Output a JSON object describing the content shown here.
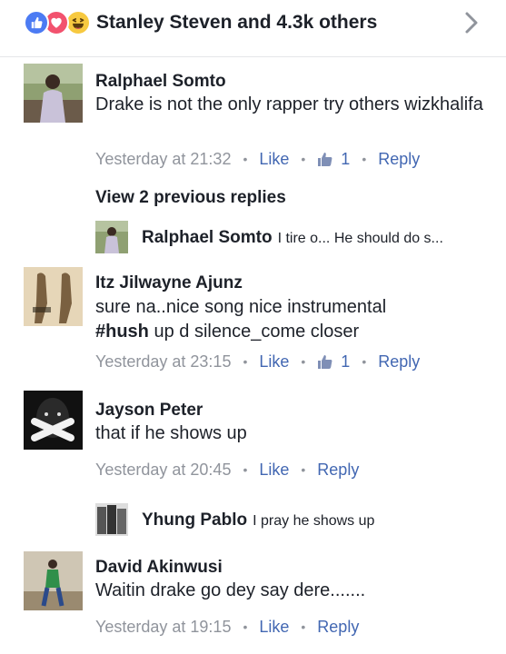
{
  "header": {
    "reaction_summary": "Stanley Steven and 4.3k others",
    "reactions": [
      "like-icon",
      "love-icon",
      "haha-icon"
    ]
  },
  "comments": [
    {
      "author": "Ralphael Somto",
      "text": "Drake is not the only rapper try others wizkhalifa",
      "time": "Yesterday at 21:32",
      "like": "Like",
      "like_count": "1",
      "reply": "Reply"
    },
    {
      "author": "Itz Jilwayne Ajunz",
      "text_prefix": "sure na..nice song nice instrumental",
      "hashtag": "#hush",
      "text_suffix": " up d silence_come closer",
      "time": "Yesterday at 23:15",
      "like": "Like",
      "like_count": "1",
      "reply": "Reply"
    },
    {
      "author": "Jayson Peter",
      "text": "that if he shows up",
      "time": "Yesterday at 20:45",
      "like": "Like",
      "reply": "Reply"
    },
    {
      "author": "David Akinwusi",
      "text": "Waitin drake go dey say dere.......",
      "time": "Yesterday at 19:15",
      "like": "Like",
      "reply": "Reply"
    }
  ],
  "view_previous": "View 2 previous replies",
  "replies": [
    {
      "author": "Ralphael Somto",
      "text": "I tire o... He should do s..."
    },
    {
      "author": "Yhung Pablo",
      "text": "I pray he shows up"
    }
  ],
  "colors": {
    "link": "#4267b2",
    "meta": "#90949c",
    "like_reaction": "#4c7bf3",
    "love_reaction": "#f2526e",
    "haha_reaction": "#f7c940"
  }
}
